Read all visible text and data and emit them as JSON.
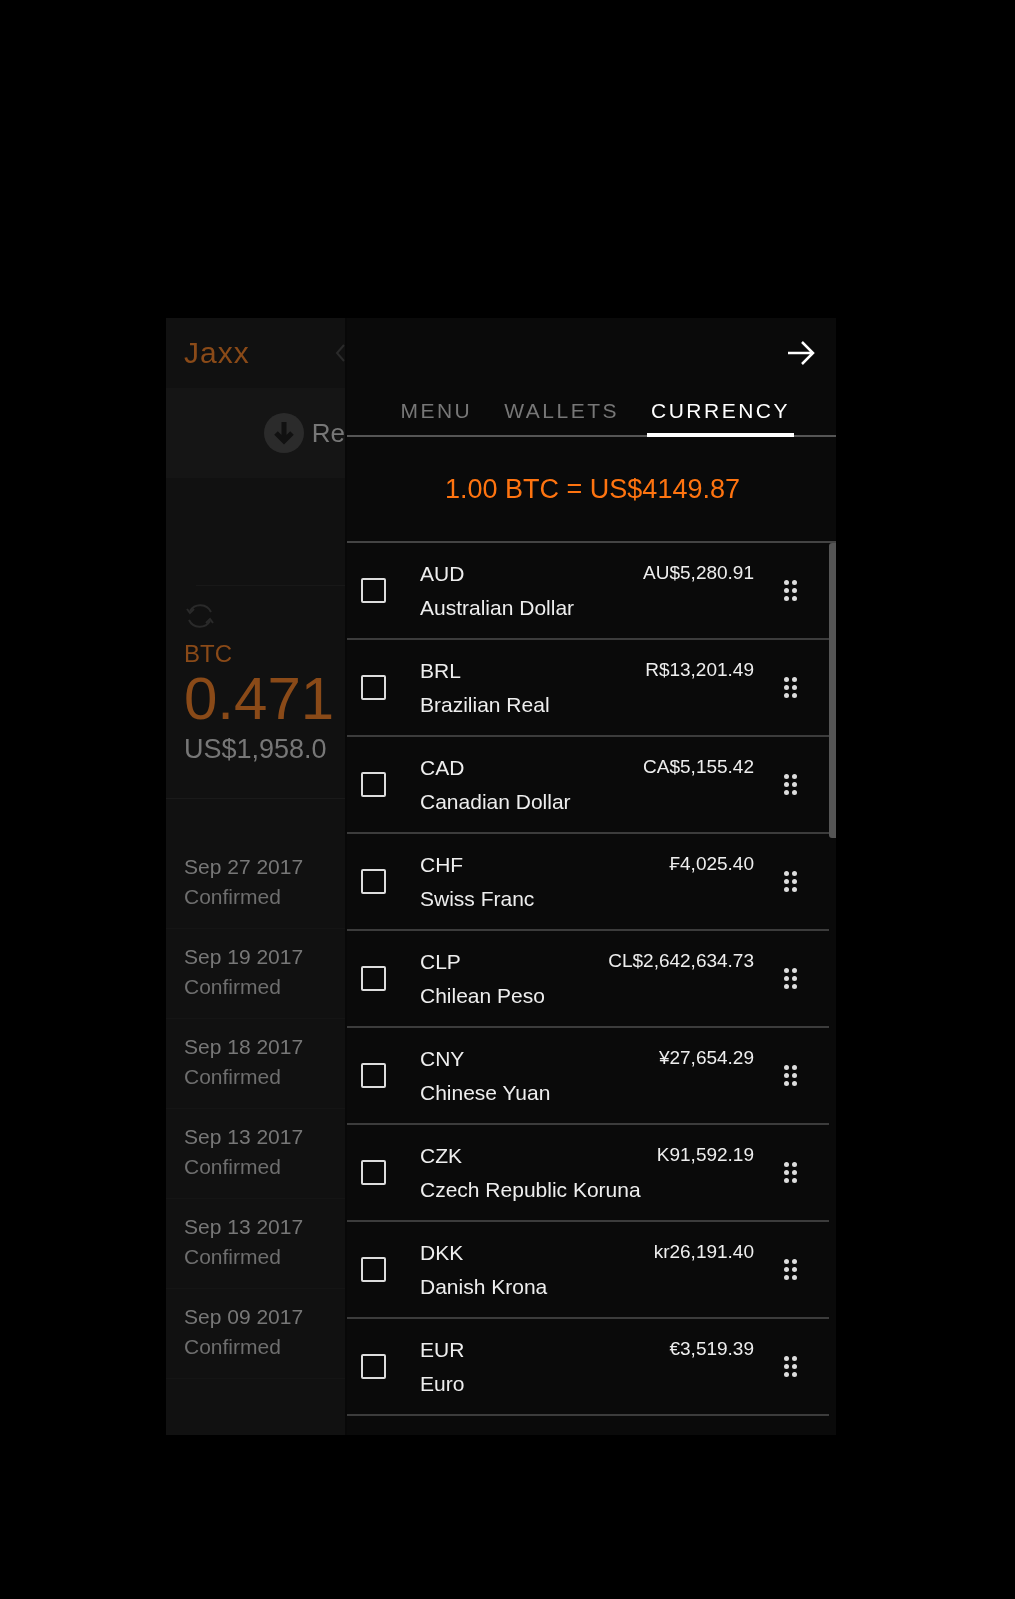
{
  "background_app": {
    "logo": "Jaxx",
    "receive_button": {
      "label": "Re"
    },
    "balance": {
      "coin": "BTC",
      "amount": "0.471",
      "fiat": "US$1,958.0"
    },
    "transactions": [
      {
        "date": "Sep 27 2017",
        "status": "Confirmed"
      },
      {
        "date": "Sep 19 2017",
        "status": "Confirmed"
      },
      {
        "date": "Sep 18 2017",
        "status": "Confirmed"
      },
      {
        "date": "Sep 13 2017",
        "status": "Confirmed"
      },
      {
        "date": "Sep 13 2017",
        "status": "Confirmed"
      },
      {
        "date": "Sep 09 2017",
        "status": "Confirmed"
      }
    ]
  },
  "drawer": {
    "tabs": [
      {
        "label": "MENU",
        "selected": false
      },
      {
        "label": "WALLETS",
        "selected": false
      },
      {
        "label": "CURRENCY",
        "selected": true
      }
    ],
    "rate": "1.00 BTC = US$4149.87",
    "currencies": [
      {
        "code": "AUD",
        "name": "Australian Dollar",
        "value": "AU$5,280.91",
        "checked": false
      },
      {
        "code": "BRL",
        "name": "Brazilian Real",
        "value": "R$13,201.49",
        "checked": false
      },
      {
        "code": "CAD",
        "name": "Canadian Dollar",
        "value": "CA$5,155.42",
        "checked": false
      },
      {
        "code": "CHF",
        "name": "Swiss Franc",
        "value": "₣4,025.40",
        "checked": false
      },
      {
        "code": "CLP",
        "name": "Chilean Peso",
        "value": "CL$2,642,634.73",
        "checked": false
      },
      {
        "code": "CNY",
        "name": "Chinese Yuan",
        "value": "¥27,654.29",
        "checked": false
      },
      {
        "code": "CZK",
        "name": "Czech Republic Koruna",
        "value": "K91,592.19",
        "checked": false
      },
      {
        "code": "DKK",
        "name": "Danish Krona",
        "value": "kr26,191.40",
        "checked": false
      },
      {
        "code": "EUR",
        "name": "Euro",
        "value": "€3,519.39",
        "checked": false
      }
    ]
  }
}
